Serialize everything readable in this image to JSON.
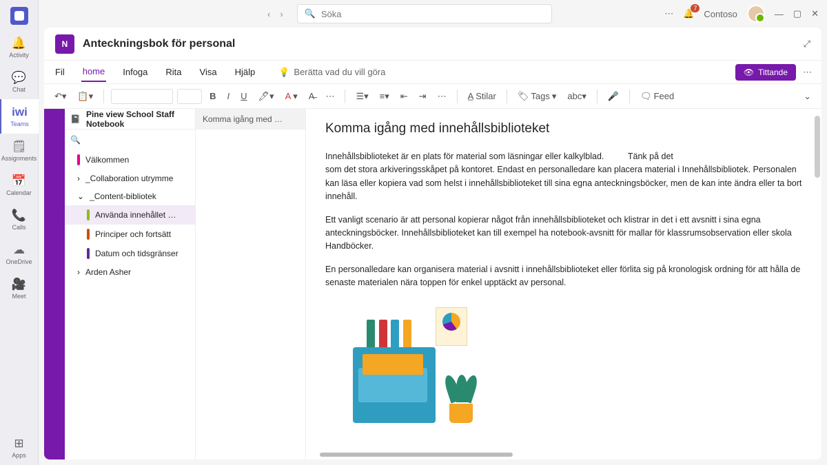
{
  "search_placeholder": "Söka",
  "tenant": "Contoso",
  "notif_count": "7",
  "rail": {
    "activity": "Activity",
    "chat": "Chat",
    "teams": "Teams",
    "teams_top": "iwi",
    "assignments": "Assignments",
    "calendar": "Calendar",
    "calls": "Calls",
    "onedrive": "OneDrive",
    "meet": "Meet",
    "apps": "Apps"
  },
  "app_title": "Anteckningsbok för personal",
  "ribbon": {
    "fil": "Fil",
    "home": "home",
    "infoga": "Infoga",
    "rita": "Rita",
    "visa": "Visa",
    "hjalp": "Hjälp",
    "tellme": "Berätta vad du vill göra",
    "viewing": "Tittande"
  },
  "toolbar": {
    "styles": "Stilar",
    "tags": "Tags",
    "feed": "Feed"
  },
  "notebook_title": "Pine view School Staff Notebook",
  "tree": {
    "welcome": "Välkommen",
    "collab": "_Collaboration utrymme",
    "content": "_Content-bibliotek",
    "using": "Använda innehållet …",
    "principles": "Principer och fortsätt",
    "dates": "Datum och tidsgränser",
    "arden": "Arden Asher"
  },
  "page_list": {
    "p1": "Komma igång med …"
  },
  "doc": {
    "title": "Komma igång med innehållsbiblioteket",
    "p1a": "Innehållsbiblioteket är en plats för material som läsningar eller kalkylblad.",
    "p1b": "Tänk på det",
    "p1c": "som det stora arkiveringsskåpet på kontoret. Endast en personalledare kan placera material i Innehållsbibliotek. Personalen kan läsa eller kopiera vad som helst i innehållsbiblioteket till sina egna anteckningsböcker, men de kan inte ändra eller ta bort innehåll.",
    "p2": "Ett vanligt scenario är att personal kopierar något från innehållsbiblioteket och klistrar in det i ett avsnitt i sina egna anteckningsböcker. Innehållsbiblioteket kan till exempel ha notebook-avsnitt för mallar för klassrumsobservation eller skola Handböcker.",
    "p3": "En personalledare kan organisera material i avsnitt i innehållsbiblioteket eller förlita sig på kronologisk ordning för att hålla de senaste materialen nära toppen för enkel upptäckt av personal."
  }
}
